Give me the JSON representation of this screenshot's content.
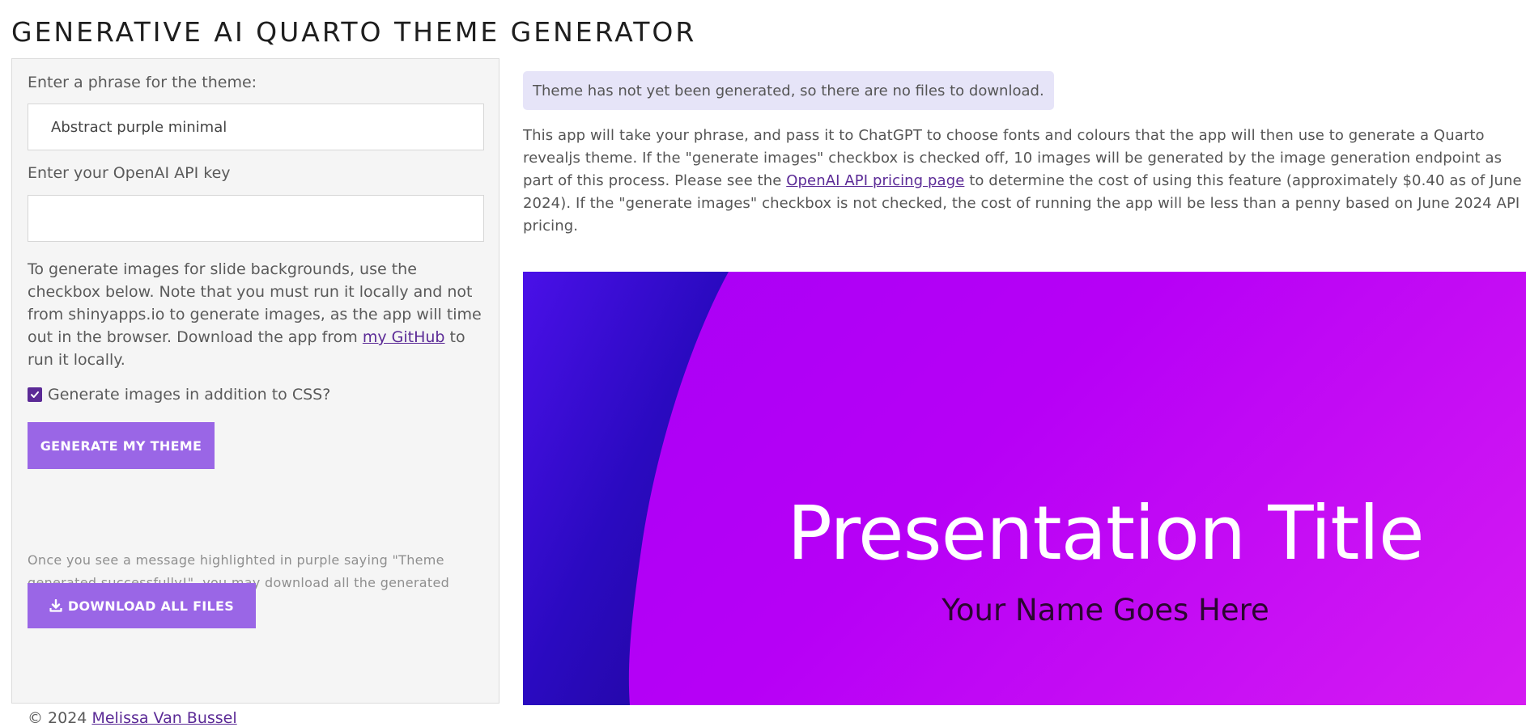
{
  "header": {
    "title": "GENERATIVE AI QUARTO THEME GENERATOR"
  },
  "sidebar": {
    "phrase_label": "Enter a phrase for the theme:",
    "phrase_value": "Abstract purple minimal",
    "api_key_label": "Enter your OpenAI API key",
    "api_key_value": "",
    "help_text_before_link": "To generate images for slide backgrounds, use the checkbox below. Note that you must run it locally and not from shinyapps.io to generate images, as the app will time out in the browser. Download the app from ",
    "help_link_text": "my GitHub",
    "help_text_after_link": " to run it locally.",
    "checkbox_label": "Generate images in addition to CSS?",
    "checkbox_checked": true,
    "generate_button_label": "GENERATE MY THEME",
    "note_text": "Once you see a message highlighted in purple saying \"Theme generated successfully!\", you may download all the generated files.",
    "download_button_label": "DOWNLOAD ALL FILES",
    "download_icon": "download-icon",
    "footer_prefix": "© 2024 ",
    "footer_link_text": "Melissa Van Bussel"
  },
  "main": {
    "alert_text": "Theme has not yet been generated, so there are no files to download.",
    "description_before_link": "This app will take your phrase, and pass it to ChatGPT to choose fonts and colours that the app will then use to generate a Quarto revealjs theme. If the \"generate images\" checkbox is checked off, 10 images will be generated by the image generation endpoint as part of this process. Please see the ",
    "description_link_text": "OpenAI API pricing page",
    "description_after_link": " to determine the cost of using this feature (approximately $0.40 as of June 2024). If the \"generate images\" checkbox is not checked, the cost of running the app will be less than a penny based on June 2024 API pricing.",
    "preview": {
      "title": "Presentation Title",
      "subtitle": "Your Name Goes Here"
    }
  },
  "colors": {
    "accent": "#9a66e6",
    "link": "#5b2a96",
    "alert_bg": "#e6e4f8",
    "sidebar_bg": "#f5f5f5",
    "preview_gradient_start": "#a700f5",
    "preview_gradient_end": "#d51bf2",
    "preview_dark": "#2a0ac0"
  }
}
